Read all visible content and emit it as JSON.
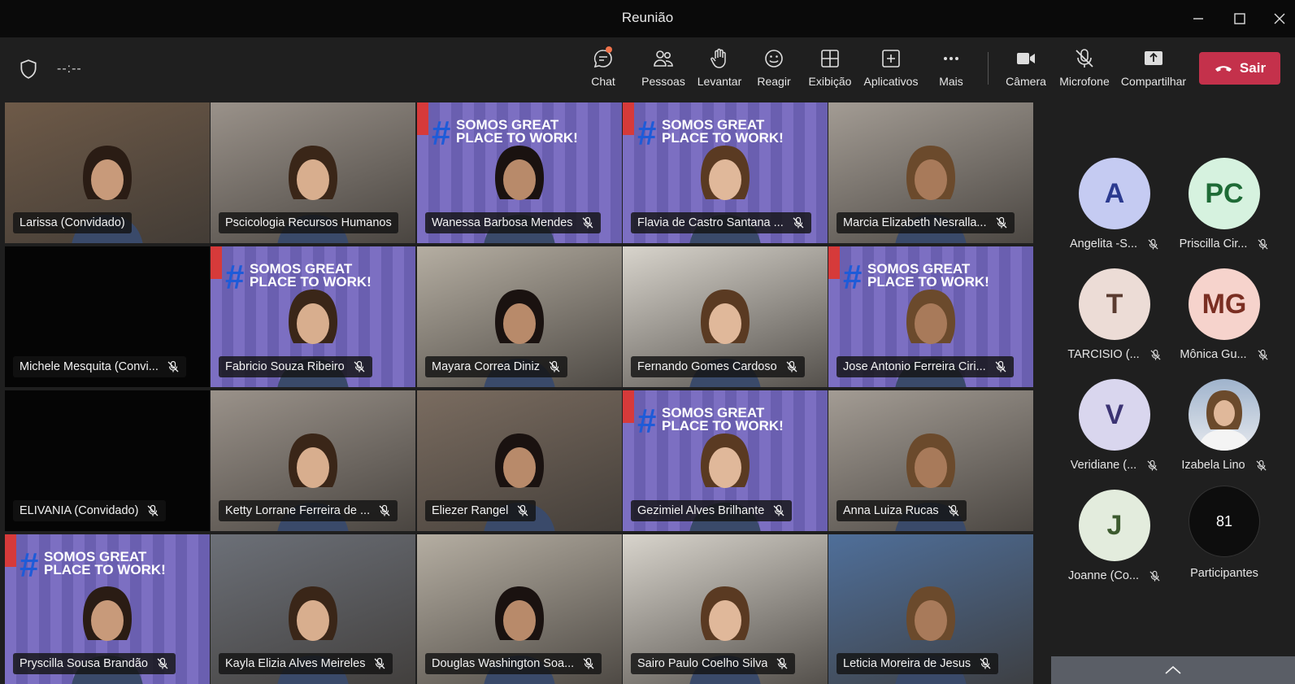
{
  "window": {
    "title": "Reunião",
    "minimize_icon": "minimize-icon",
    "maximize_icon": "maximize-icon",
    "close_icon": "close-icon"
  },
  "toolbar": {
    "timer": "--:--",
    "buttons": [
      {
        "label": "Chat",
        "icon": "chat-icon"
      },
      {
        "label": "Pessoas",
        "icon": "people-icon"
      },
      {
        "label": "Levantar",
        "icon": "raise-hand-icon"
      },
      {
        "label": "Reagir",
        "icon": "smile-icon"
      },
      {
        "label": "Exibição",
        "icon": "view-grid-icon"
      },
      {
        "label": "Aplicativos",
        "icon": "add-app-icon"
      },
      {
        "label": "Mais",
        "icon": "more-icon"
      },
      {
        "label": "Câmera",
        "icon": "camera-icon"
      },
      {
        "label": "Microfone",
        "icon": "mic-off-icon"
      },
      {
        "label": "Compartilhar",
        "icon": "share-icon"
      }
    ],
    "leave_label": "Sair"
  },
  "gptw": {
    "hash": "#",
    "slogan_1": "SOMOS GREAT",
    "slogan_2": "PLACE TO WORK!"
  },
  "tiles": [
    {
      "name": "Larissa (Convidado)",
      "muted": false,
      "selected": true,
      "bg": "video"
    },
    {
      "name": "Pscicologia Recursos Humanos",
      "muted": false,
      "selected": true,
      "bg": "video"
    },
    {
      "name": "Wanessa Barbosa Mendes",
      "muted": true,
      "bg": "gptw"
    },
    {
      "name": "Flavia de Castro Santana ...",
      "muted": true,
      "bg": "gptw"
    },
    {
      "name": "Marcia Elizabeth Nesralla...",
      "muted": true,
      "bg": "video"
    },
    {
      "name": "Michele Mesquita (Convi...",
      "muted": true,
      "bg": "black"
    },
    {
      "name": "Fabricio Souza Ribeiro",
      "muted": true,
      "bg": "gptw"
    },
    {
      "name": "Mayara Correa Diniz",
      "muted": true,
      "bg": "video"
    },
    {
      "name": "Fernando Gomes Cardoso",
      "muted": true,
      "bg": "video"
    },
    {
      "name": "Jose Antonio Ferreira Ciri...",
      "muted": true,
      "bg": "gptw"
    },
    {
      "name": "ELIVANIA (Convidado)",
      "muted": true,
      "bg": "black"
    },
    {
      "name": "Ketty Lorrane Ferreira de ...",
      "muted": true,
      "bg": "video"
    },
    {
      "name": "Eliezer Rangel",
      "muted": true,
      "bg": "video"
    },
    {
      "name": "Gezimiel Alves Brilhante",
      "muted": true,
      "bg": "gptw"
    },
    {
      "name": "Anna Luiza Rucas",
      "muted": true,
      "bg": "video"
    },
    {
      "name": "Pryscilla Sousa Brandão",
      "muted": true,
      "bg": "gptw"
    },
    {
      "name": "Kayla Elizia Alves Meireles",
      "muted": true,
      "bg": "video"
    },
    {
      "name": "Douglas Washington Soa...",
      "muted": true,
      "bg": "video"
    },
    {
      "name": "Sairo Paulo Coelho Silva",
      "muted": true,
      "bg": "video"
    },
    {
      "name": "Leticia Moreira de Jesus",
      "muted": true,
      "bg": "video"
    }
  ],
  "sidebar": {
    "people": [
      {
        "initials": "A",
        "name": "Angelita -S...",
        "bg": "#c5cbf2",
        "fg": "#2b3a8f"
      },
      {
        "initials": "PC",
        "name": "Priscilla Cir...",
        "bg": "#d6f2df",
        "fg": "#1e6b36"
      },
      {
        "initials": "T",
        "name": "TARCISIO (...",
        "bg": "#ecdcd6",
        "fg": "#5a3b30"
      },
      {
        "initials": "MG",
        "name": "Mônica Gu...",
        "bg": "#f6d3cc",
        "fg": "#7a2e22"
      },
      {
        "initials": "V",
        "name": "Veridiane (...",
        "bg": "#d9d6ee",
        "fg": "#3b3373"
      },
      {
        "initials": "",
        "name": "Izabela Lino",
        "bg": "#c9d4e6",
        "fg": "#333"
      },
      {
        "initials": "J",
        "name": "Joanne (Co...",
        "bg": "#e3ecdd",
        "fg": "#3c5a2e"
      }
    ],
    "participants_count": "81",
    "participants_label": "Participantes"
  }
}
